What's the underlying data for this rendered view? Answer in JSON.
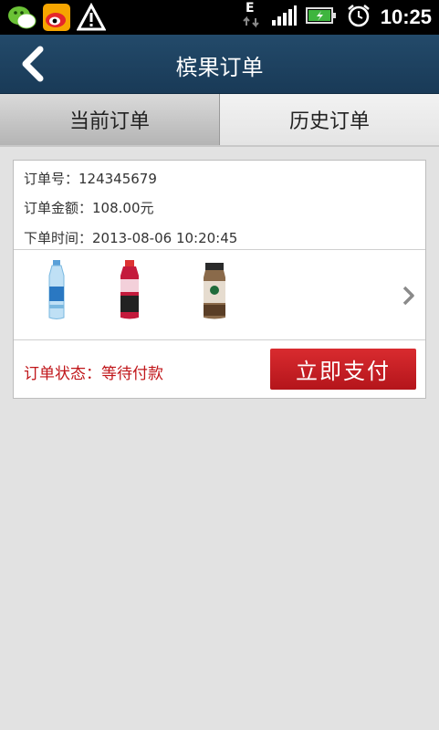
{
  "statusbar": {
    "time": "10:25",
    "icons": [
      "wechat-icon",
      "weibo-icon",
      "warning-icon",
      "edge-data-icon",
      "signal-icon",
      "battery-icon",
      "alarm-icon"
    ]
  },
  "titlebar": {
    "title": "槟果订单",
    "back_icon": "back-arrow-icon"
  },
  "tabs": [
    {
      "label": "当前订单",
      "active": true
    },
    {
      "label": "历史订单",
      "active": false
    }
  ],
  "order": {
    "order_no": "订单号：124345679",
    "amount": "订单金额：108.00元",
    "time": "下单时间：2013-08-06 10:20:45",
    "products": [
      "water-bottle",
      "red-drink-bottle",
      "coffee-bottle"
    ],
    "status": "订单状态：等待付款",
    "pay_label": "立即支付"
  },
  "colors": {
    "titlebar": "#1f4464",
    "accent_red": "#c0161a",
    "page_bg": "#e2e2e2"
  }
}
